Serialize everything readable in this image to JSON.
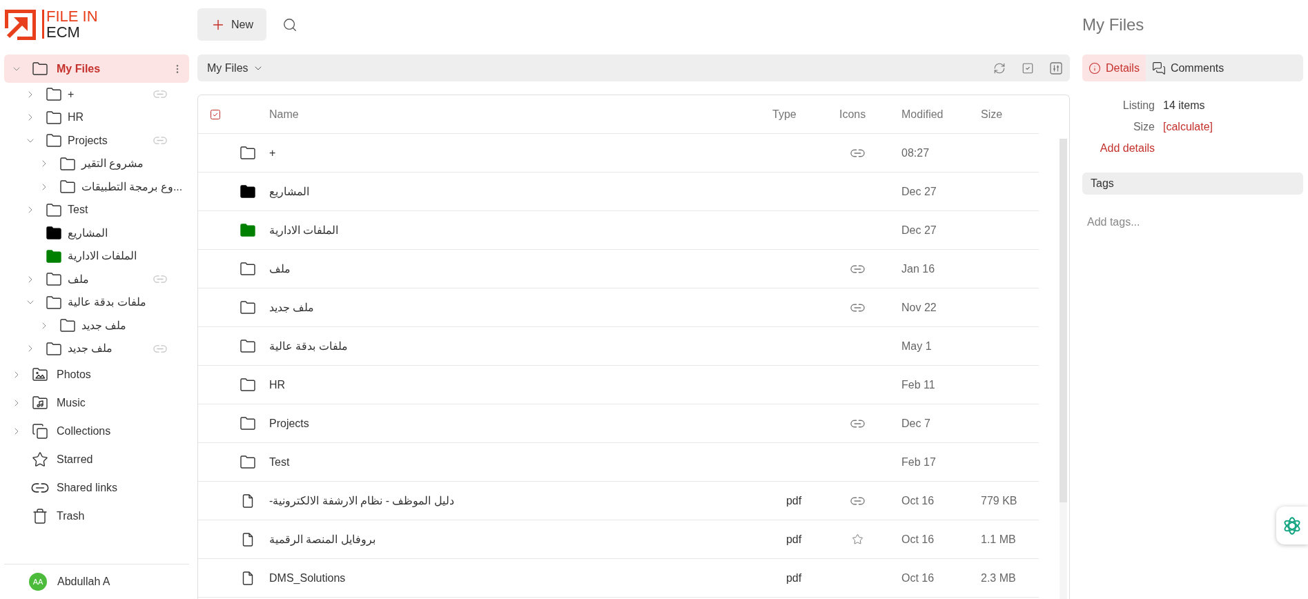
{
  "logo": {
    "line_1": "FILE IN",
    "line_2": "ECM"
  },
  "sidebar": {
    "tree": [
      {
        "label": "My Files",
        "kind": "folder",
        "expanded": true,
        "selected": true,
        "shared": false,
        "children": [
          {
            "label": "+",
            "kind": "folder",
            "expanded": false,
            "selected": false,
            "shared": true
          },
          {
            "label": "HR",
            "kind": "folder",
            "expanded": false,
            "selected": false,
            "shared": false
          },
          {
            "label": "Projects",
            "kind": "folder",
            "expanded": true,
            "selected": false,
            "shared": true,
            "children": [
              {
                "label": "مشروع التقير",
                "kind": "folder",
                "expanded": false,
                "selected": false,
                "shared": false
              },
              {
                "label": "وع برمجة التطبيقات...",
                "kind": "folder",
                "expanded": false,
                "selected": false,
                "shared": false
              }
            ]
          },
          {
            "label": "Test",
            "kind": "folder",
            "expanded": false,
            "selected": false,
            "shared": false
          },
          {
            "label": "المشاريع",
            "kind": "filled_folder",
            "color": "#000000",
            "selected": false,
            "shared": false
          },
          {
            "label": "الملفات الادارية",
            "kind": "filled_folder",
            "color": "#008000",
            "selected": false,
            "shared": false
          },
          {
            "label": "ملف",
            "kind": "folder",
            "expanded": false,
            "selected": false,
            "shared": true
          },
          {
            "label": "ملفات بدقة عالية",
            "kind": "folder",
            "expanded": true,
            "selected": false,
            "shared": false,
            "children": [
              {
                "label": "ملف جديد",
                "kind": "folder",
                "expanded": false,
                "selected": false,
                "shared": false
              }
            ]
          },
          {
            "label": "ملف جديد",
            "kind": "folder",
            "expanded": false,
            "selected": false,
            "shared": true
          }
        ]
      },
      {
        "label": "Photos",
        "kind": "photos",
        "expanded": false,
        "selected": false,
        "shared": false
      },
      {
        "label": "Music",
        "kind": "music",
        "expanded": false,
        "selected": false,
        "shared": false
      },
      {
        "label": "Collections",
        "kind": "collections",
        "expanded": false,
        "selected": false,
        "shared": false
      },
      {
        "label": "Starred",
        "kind": "star",
        "selected": false,
        "shared": false
      },
      {
        "label": "Shared links",
        "kind": "link",
        "selected": false,
        "shared": false
      },
      {
        "label": "Trash",
        "kind": "trash",
        "selected": false,
        "shared": false
      }
    ],
    "user": {
      "initials": "AA",
      "name": "Abdullah A"
    }
  },
  "toolbar": {
    "new_button": "New"
  },
  "breadcrumb": {
    "label": "My Files"
  },
  "table": {
    "select_all_checked": true,
    "columns": [
      "Name",
      "Type",
      "Icons",
      "Modified",
      "Size"
    ],
    "rows": [
      {
        "kind": "folder",
        "name": "+",
        "shared": true,
        "starred": false,
        "modified": "08:27"
      },
      {
        "kind": "filled_folder",
        "color": "#000000",
        "name": "المشاريع",
        "shared": false,
        "starred": false,
        "modified": "Dec 27"
      },
      {
        "kind": "filled_folder",
        "color": "#008000",
        "name": "الملفات الادارية",
        "shared": false,
        "starred": false,
        "modified": "Dec 27"
      },
      {
        "kind": "folder",
        "name": "ملف",
        "shared": true,
        "starred": false,
        "modified": "Jan 16"
      },
      {
        "kind": "folder",
        "name": "ملف جديد",
        "shared": true,
        "starred": false,
        "modified": "Nov 22"
      },
      {
        "kind": "folder",
        "name": "ملفات بدقة عالية",
        "shared": false,
        "starred": false,
        "modified": "May 1"
      },
      {
        "kind": "folder",
        "name": "HR",
        "shared": false,
        "starred": false,
        "modified": "Feb 11"
      },
      {
        "kind": "folder",
        "name": "Projects",
        "shared": true,
        "starred": false,
        "modified": "Dec 7"
      },
      {
        "kind": "folder",
        "name": "Test",
        "shared": false,
        "starred": false,
        "modified": "Feb 17"
      },
      {
        "kind": "file",
        "name": "-دليل الموظف - نظام الارشفة الالكترونية",
        "type": "pdf",
        "shared": true,
        "starred": false,
        "modified": "Oct 16",
        "size": "779 KB"
      },
      {
        "kind": "file",
        "name": "بروفايل المنصة الرقمية",
        "type": "pdf",
        "shared": false,
        "starred": true,
        "modified": "Oct 16",
        "size": "1.1 MB"
      },
      {
        "kind": "file",
        "name": "DMS_Solutions",
        "type": "pdf",
        "shared": false,
        "starred": false,
        "modified": "Oct 16",
        "size": "2.3 MB"
      }
    ]
  },
  "details_panel": {
    "title": "My Files",
    "tabs": [
      {
        "label": "Details",
        "kind": "info",
        "selected": true
      },
      {
        "label": "Comments",
        "kind": "comments",
        "selected": false
      }
    ],
    "properties": [
      {
        "label": "Listing",
        "value": "14 items",
        "kind": "text"
      },
      {
        "label": "Size",
        "value": "[calculate]",
        "kind": "link"
      }
    ],
    "add_details": "Add details",
    "tags_header": "Tags",
    "tags_input": {
      "placeholder": "Add tags..."
    }
  }
}
